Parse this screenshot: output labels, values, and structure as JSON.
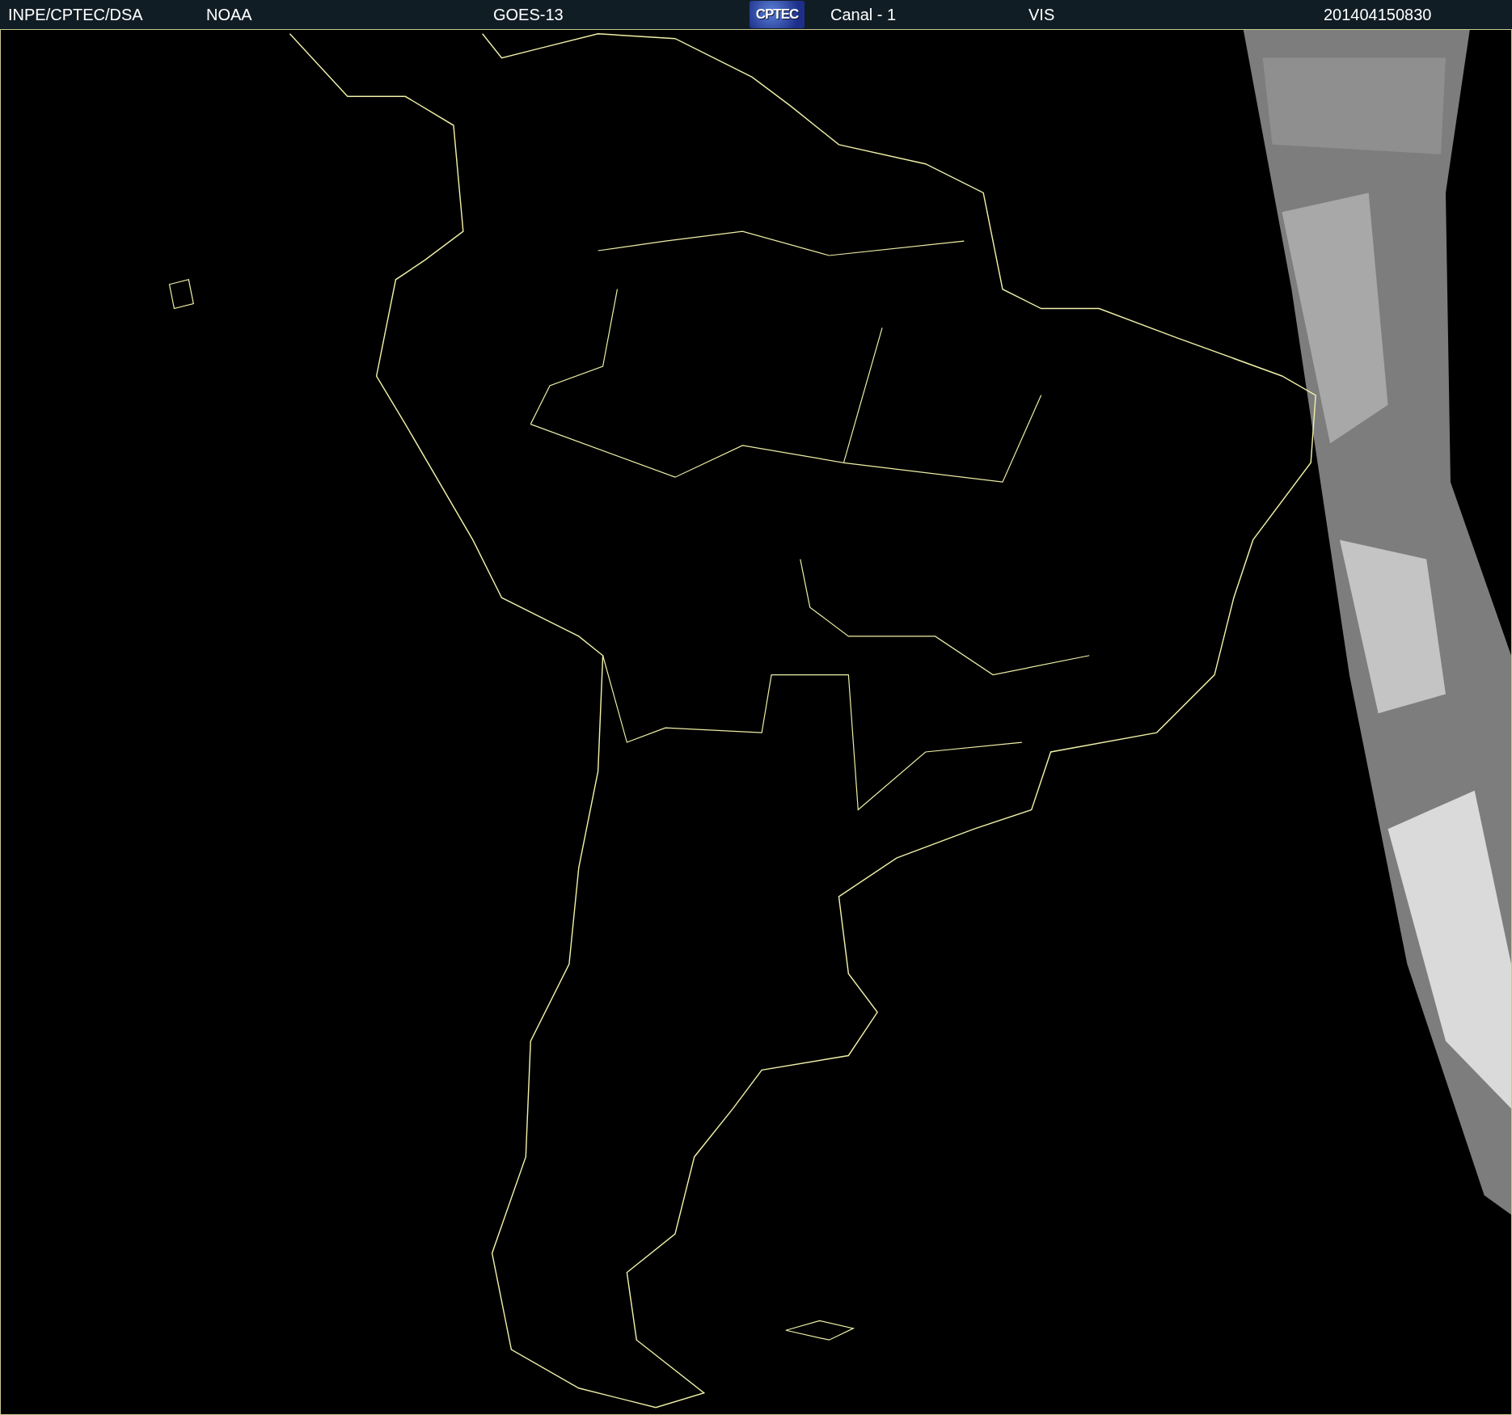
{
  "header": {
    "items": [
      {
        "kind": "text",
        "text": "INPE/CPTEC/DSA"
      },
      {
        "kind": "text",
        "text": "NOAA"
      },
      {
        "kind": "text",
        "text": "GOES-13"
      },
      {
        "kind": "logo",
        "text": "CPTEC"
      },
      {
        "kind": "text",
        "text": "Canal - 1"
      },
      {
        "kind": "text",
        "text": "VIS"
      },
      {
        "kind": "text",
        "text": "201404150830"
      }
    ]
  }
}
